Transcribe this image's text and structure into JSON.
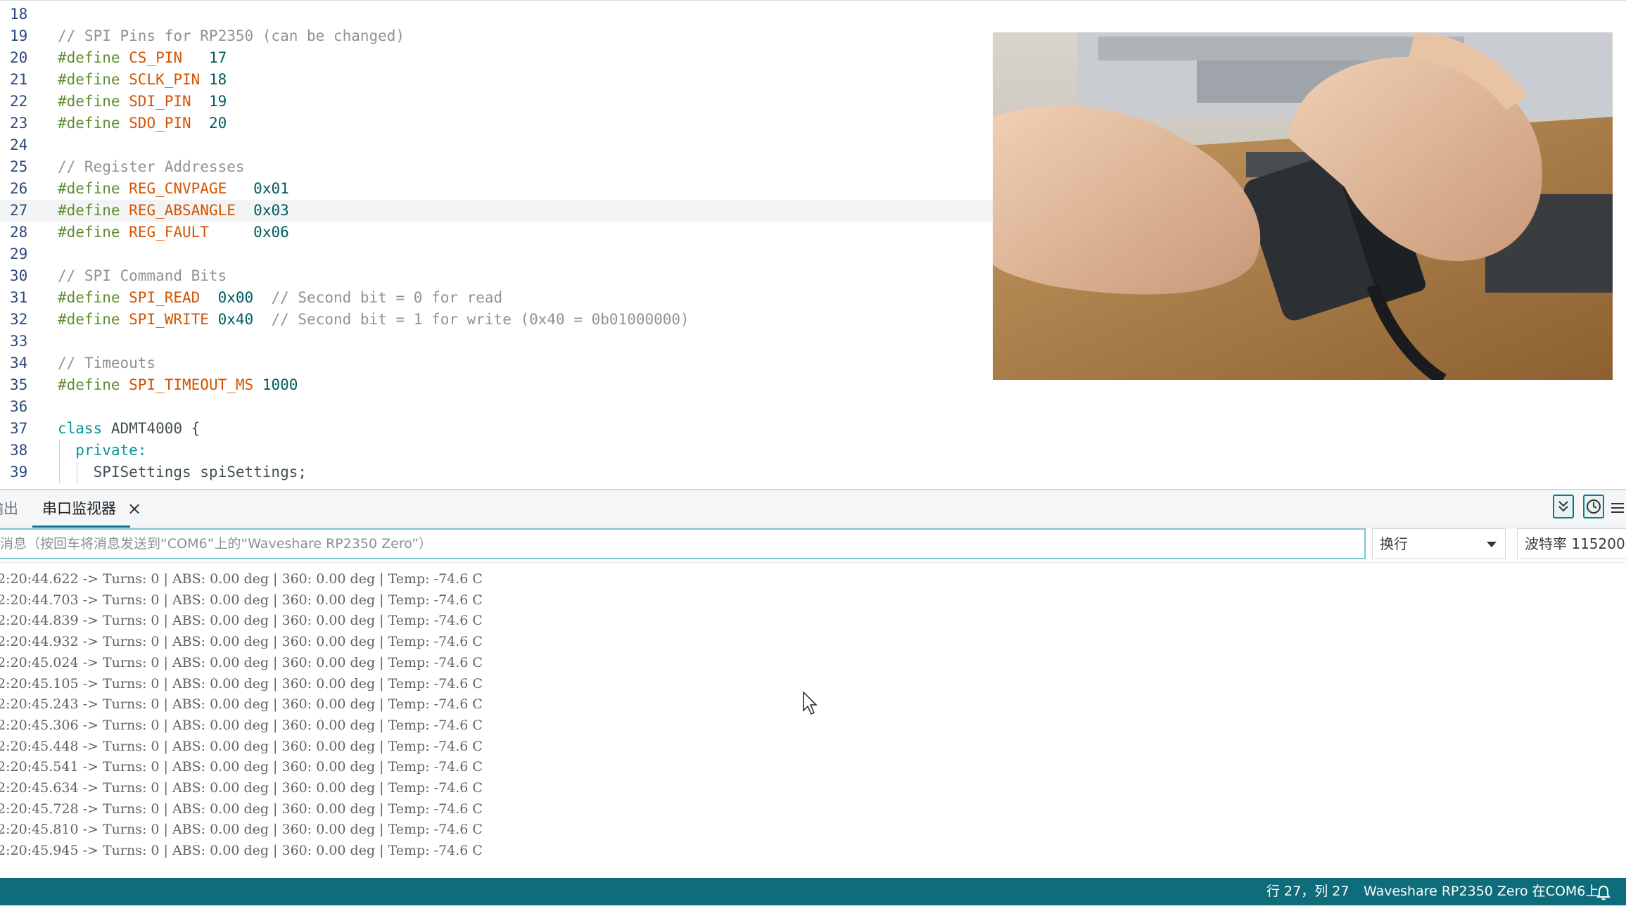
{
  "editor": {
    "lines": [
      {
        "n": "18",
        "tokens": []
      },
      {
        "n": "19",
        "tokens": [
          {
            "t": "// SPI Pins for RP2350 (can be changed)",
            "c": "comment"
          }
        ]
      },
      {
        "n": "20",
        "tokens": [
          {
            "t": "#define ",
            "c": "pre"
          },
          {
            "t": "CS_PIN",
            "c": "macro"
          },
          {
            "t": "   ",
            "c": "plain"
          },
          {
            "t": "17",
            "c": "num"
          }
        ]
      },
      {
        "n": "21",
        "tokens": [
          {
            "t": "#define ",
            "c": "pre"
          },
          {
            "t": "SCLK_PIN",
            "c": "macro"
          },
          {
            "t": " ",
            "c": "plain"
          },
          {
            "t": "18",
            "c": "num"
          }
        ]
      },
      {
        "n": "22",
        "tokens": [
          {
            "t": "#define ",
            "c": "pre"
          },
          {
            "t": "SDI_PIN",
            "c": "macro"
          },
          {
            "t": "  ",
            "c": "plain"
          },
          {
            "t": "19",
            "c": "num"
          }
        ]
      },
      {
        "n": "23",
        "tokens": [
          {
            "t": "#define ",
            "c": "pre"
          },
          {
            "t": "SDO_PIN",
            "c": "macro"
          },
          {
            "t": "  ",
            "c": "plain"
          },
          {
            "t": "20",
            "c": "num"
          }
        ]
      },
      {
        "n": "24",
        "tokens": []
      },
      {
        "n": "25",
        "tokens": [
          {
            "t": "// Register Addresses",
            "c": "comment"
          }
        ]
      },
      {
        "n": "26",
        "tokens": [
          {
            "t": "#define ",
            "c": "pre"
          },
          {
            "t": "REG_CNVPAGE",
            "c": "macro"
          },
          {
            "t": "   ",
            "c": "plain"
          },
          {
            "t": "0x01",
            "c": "num"
          }
        ]
      },
      {
        "n": "27",
        "tokens": [
          {
            "t": "#define ",
            "c": "pre"
          },
          {
            "t": "REG_ABSANGLE",
            "c": "macro"
          },
          {
            "t": "  ",
            "c": "plain"
          },
          {
            "t": "0x03",
            "c": "num"
          }
        ],
        "current": true
      },
      {
        "n": "28",
        "tokens": [
          {
            "t": "#define ",
            "c": "pre"
          },
          {
            "t": "REG_FAULT",
            "c": "macro"
          },
          {
            "t": "     ",
            "c": "plain"
          },
          {
            "t": "0x06",
            "c": "num"
          }
        ]
      },
      {
        "n": "29",
        "tokens": []
      },
      {
        "n": "30",
        "tokens": [
          {
            "t": "// SPI Command Bits",
            "c": "comment"
          }
        ]
      },
      {
        "n": "31",
        "tokens": [
          {
            "t": "#define ",
            "c": "pre"
          },
          {
            "t": "SPI_READ",
            "c": "macro"
          },
          {
            "t": "  ",
            "c": "plain"
          },
          {
            "t": "0x00",
            "c": "num"
          },
          {
            "t": "  // Second bit = 0 for read",
            "c": "comment"
          }
        ]
      },
      {
        "n": "32",
        "tokens": [
          {
            "t": "#define ",
            "c": "pre"
          },
          {
            "t": "SPI_WRITE",
            "c": "macro"
          },
          {
            "t": " ",
            "c": "plain"
          },
          {
            "t": "0x40",
            "c": "num"
          },
          {
            "t": "  // Second bit = 1 for write (0x40 = 0b01000000)",
            "c": "comment"
          }
        ]
      },
      {
        "n": "33",
        "tokens": []
      },
      {
        "n": "34",
        "tokens": [
          {
            "t": "// Timeouts",
            "c": "comment"
          }
        ]
      },
      {
        "n": "35",
        "tokens": [
          {
            "t": "#define ",
            "c": "pre"
          },
          {
            "t": "SPI_TIMEOUT_MS",
            "c": "macro"
          },
          {
            "t": " ",
            "c": "plain"
          },
          {
            "t": "1000",
            "c": "num"
          }
        ]
      },
      {
        "n": "36",
        "tokens": []
      },
      {
        "n": "37",
        "tokens": [
          {
            "t": "class",
            "c": "kw"
          },
          {
            "t": " ADMT4000 {",
            "c": "plain"
          }
        ]
      },
      {
        "n": "38",
        "tokens": [
          {
            "t": "  ",
            "c": "plain"
          },
          {
            "t": "private:",
            "c": "kw"
          }
        ]
      },
      {
        "n": "39",
        "tokens": [
          {
            "t": "    SPISettings spiSettings;",
            "c": "plain"
          }
        ]
      }
    ]
  },
  "panel": {
    "tab_output": "输出",
    "tab_serial": "串口监视器",
    "close_glyph": "×",
    "message_placeholder": "消息（按回车将消息发送到“COM6”上的“Waveshare RP2350 Zero”）",
    "line_ending": "换行",
    "baud": "波特率 115200",
    "icons": [
      "autoscroll-icon",
      "timestamp-icon",
      "menu-icon"
    ]
  },
  "serial": {
    "lines": [
      "2:20:44.622 -> Turns: 0 | ABS: 0.00 deg | 360: 0.00 deg | Temp: -74.6 C",
      "2:20:44.703 -> Turns: 0 | ABS: 0.00 deg | 360: 0.00 deg | Temp: -74.6 C",
      "2:20:44.839 -> Turns: 0 | ABS: 0.00 deg | 360: 0.00 deg | Temp: -74.6 C",
      "2:20:44.932 -> Turns: 0 | ABS: 0.00 deg | 360: 0.00 deg | Temp: -74.6 C",
      "2:20:45.024 -> Turns: 0 | ABS: 0.00 deg | 360: 0.00 deg | Temp: -74.6 C",
      "2:20:45.105 -> Turns: 0 | ABS: 0.00 deg | 360: 0.00 deg | Temp: -74.6 C",
      "2:20:45.243 -> Turns: 0 | ABS: 0.00 deg | 360: 0.00 deg | Temp: -74.6 C",
      "2:20:45.306 -> Turns: 0 | ABS: 0.00 deg | 360: 0.00 deg | Temp: -74.6 C",
      "2:20:45.448 -> Turns: 0 | ABS: 0.00 deg | 360: 0.00 deg | Temp: -74.6 C",
      "2:20:45.541 -> Turns: 0 | ABS: 0.00 deg | 360: 0.00 deg | Temp: -74.6 C",
      "2:20:45.634 -> Turns: 0 | ABS: 0.00 deg | 360: 0.00 deg | Temp: -74.6 C",
      "2:20:45.728 -> Turns: 0 | ABS: 0.00 deg | 360: 0.00 deg | Temp: -74.6 C",
      "2:20:45.810 -> Turns: 0 | ABS: 0.00 deg | 360: 0.00 deg | Temp: -74.6 C",
      "2:20:45.945 -> Turns: 0 | ABS: 0.00 deg | 360: 0.00 deg | Temp: -74.6 C"
    ]
  },
  "status": {
    "cursor": "行 27，列 27",
    "board": "Waveshare RP2350 Zero 在COM6上",
    "bell_icon": "bell-icon"
  },
  "colors": {
    "accent": "#0f7b8a",
    "status_bar": "#0f6c7a",
    "comment": "#8c9497",
    "preprocessor": "#5f8d32",
    "macro": "#d35400",
    "number": "#005c5f",
    "keyword": "#00979d"
  }
}
